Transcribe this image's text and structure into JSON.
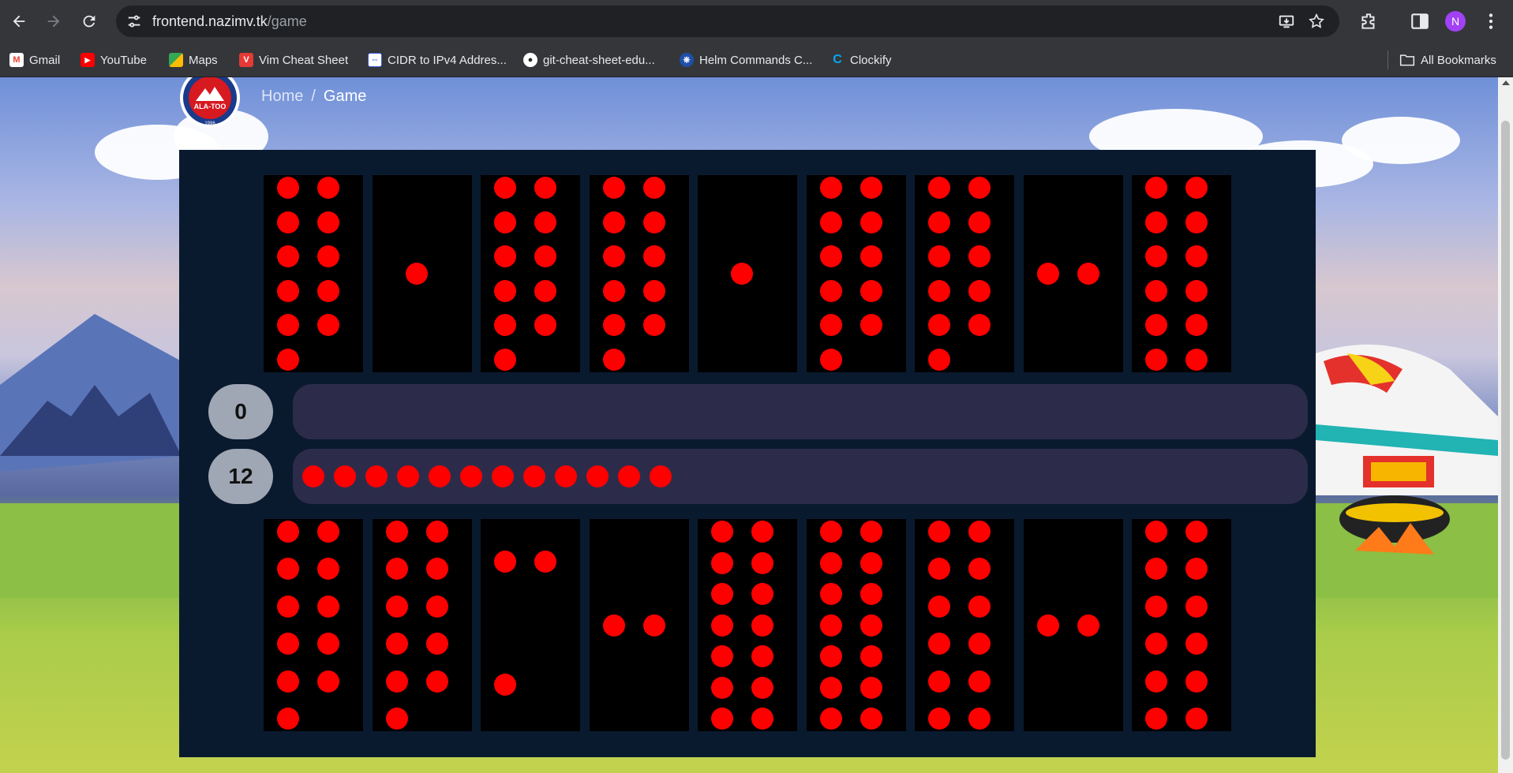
{
  "browser": {
    "url_host": "frontend.nazimv.tk",
    "url_path": "/game",
    "profile_initial": "N",
    "bookmarks": [
      {
        "label": "Gmail",
        "icon": "gmail-icon",
        "color": "#ea4335"
      },
      {
        "label": "YouTube",
        "icon": "youtube-icon",
        "color": "#ff0000"
      },
      {
        "label": "Maps",
        "icon": "maps-icon",
        "color": "#34a853"
      },
      {
        "label": "Vim Cheat Sheet",
        "icon": "vim-icon",
        "color": "#e53935"
      },
      {
        "label": "CIDR to IPv4 Addres...",
        "icon": "cidr-icon",
        "color": "#3b5bdb"
      },
      {
        "label": "git-cheat-sheet-edu...",
        "icon": "github-icon",
        "color": "#24292e"
      },
      {
        "label": "Helm Commands C...",
        "icon": "helm-icon",
        "color": "#1e4fa8"
      },
      {
        "label": "Clockify",
        "icon": "clockify-icon",
        "color": "#03a9f4"
      }
    ],
    "all_bookmarks": "All Bookmarks"
  },
  "header": {
    "logo_text": "ALA-TOO",
    "logo_year": "1996",
    "breadcrumb": {
      "home": "Home",
      "separator": "/",
      "current": "Game"
    }
  },
  "game": {
    "ball_color": "#ff0000",
    "top_pits": [
      11,
      1,
      11,
      11,
      1,
      11,
      11,
      2,
      12
    ],
    "bottom_pits": [
      11,
      11,
      3,
      2,
      14,
      14,
      12,
      2,
      12
    ],
    "top_score": "0",
    "bottom_score": "12",
    "top_kazan_balls": 0,
    "bottom_kazan_balls": 12
  }
}
